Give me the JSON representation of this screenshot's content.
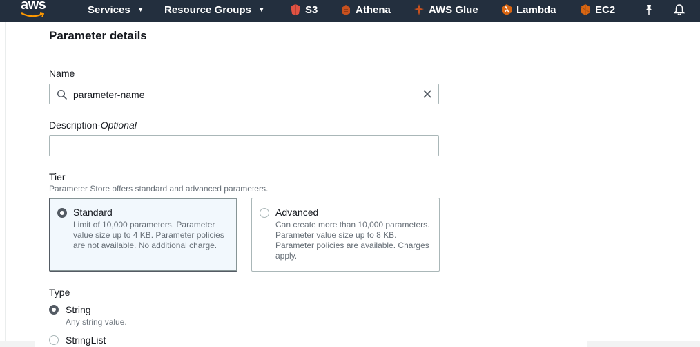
{
  "topnav": {
    "logo": "aws",
    "services_label": "Services",
    "resource_groups_label": "Resource Groups",
    "shortcuts": [
      {
        "label": "S3",
        "icon": "s3-icon",
        "color": "#e05243"
      },
      {
        "label": "Athena",
        "icon": "athena-icon",
        "color": "#c7511f"
      },
      {
        "label": "AWS Glue",
        "icon": "glue-icon",
        "color": "#c7511f"
      },
      {
        "label": "Lambda",
        "icon": "lambda-icon",
        "color": "#d86613"
      },
      {
        "label": "EC2",
        "icon": "ec2-icon",
        "color": "#d86613"
      }
    ],
    "pin_icon": "pin-icon",
    "bell_icon": "bell-icon"
  },
  "panel": {
    "title": "Parameter details",
    "name": {
      "label": "Name",
      "value": "parameter-name"
    },
    "description": {
      "label": "Description-",
      "optional": "Optional",
      "value": ""
    },
    "tier": {
      "label": "Tier",
      "hint": "Parameter Store offers standard and advanced parameters.",
      "options": [
        {
          "title": "Standard",
          "description": "Limit of 10,000 parameters. Parameter value size up to 4 KB. Parameter policies are not available. No additional charge.",
          "selected": true
        },
        {
          "title": "Advanced",
          "description": "Can create more than 10,000 parameters. Parameter value size up to 8 KB. Parameter policies are available. Charges apply.",
          "selected": false
        }
      ]
    },
    "type": {
      "label": "Type",
      "options": [
        {
          "title": "String",
          "description": "Any string value.",
          "selected": true
        },
        {
          "title": "StringList",
          "description": "",
          "selected": false
        }
      ]
    }
  },
  "colors": {
    "nav_bg": "#232f3e",
    "text": "#16191f",
    "muted": "#687078",
    "selected_radio": "#545b64"
  }
}
